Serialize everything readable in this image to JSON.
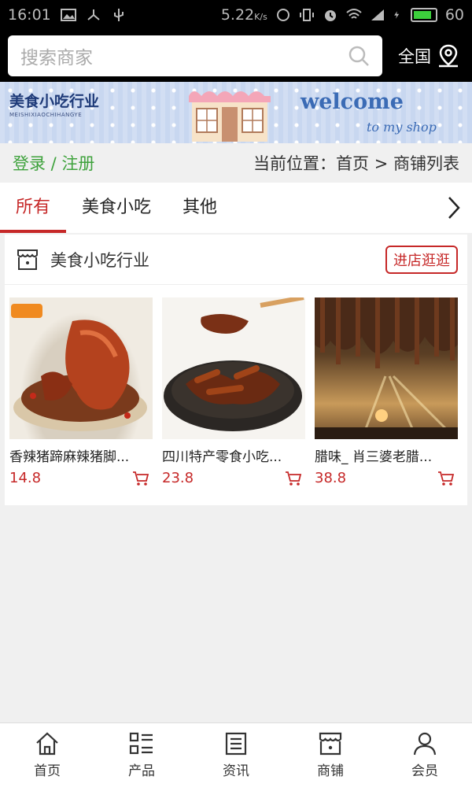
{
  "status_bar": {
    "time": "16:01",
    "speed": "5.22",
    "speed_unit": "K/s",
    "battery": "60"
  },
  "header": {
    "search_placeholder": "搜索商家",
    "region": "全国"
  },
  "banner": {
    "brand": "美食小吃行业",
    "brand_sub": "MEISHIXIAOCHIHANGYE",
    "welcome": "welcome",
    "tagline": "to my shop"
  },
  "location": {
    "login": "登录 / 注册",
    "breadcrumb": "当前位置：首页 > 商铺列表"
  },
  "tabs": [
    {
      "label": "所有",
      "active": true
    },
    {
      "label": "美食小吃",
      "active": false
    },
    {
      "label": "其他",
      "active": false
    }
  ],
  "store": {
    "name": "美食小吃行业",
    "enter_label": "进店逛逛",
    "products": [
      {
        "title": "香辣猪蹄麻辣猪脚...",
        "price": "14.8"
      },
      {
        "title": "四川特产零食小吃...",
        "price": "23.8"
      },
      {
        "title": "腊味_ 肖三婆老腊...",
        "price": "38.8"
      }
    ]
  },
  "bottom_nav": [
    {
      "label": "首页",
      "icon": "home-icon"
    },
    {
      "label": "产品",
      "icon": "grid-list-icon"
    },
    {
      "label": "资讯",
      "icon": "news-icon"
    },
    {
      "label": "商铺",
      "icon": "store-icon"
    },
    {
      "label": "会员",
      "icon": "user-icon"
    }
  ],
  "colors": {
    "accent": "#c62828",
    "login_green": "#3ea23c",
    "header_bg": "#000000"
  }
}
